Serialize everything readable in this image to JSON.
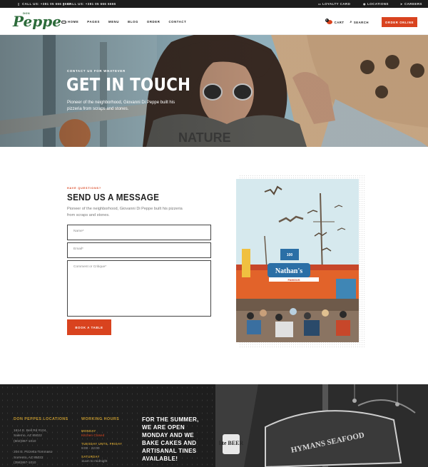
{
  "topbar": {
    "call1": "CALL US: +381 05 666 6666",
    "call2": "CALL US: +381 05 666 6666",
    "loyalty": "LOYALTY CARD",
    "locations": "LOCATIONS",
    "careers": "CAREERS"
  },
  "nav": {
    "logo": "Peppe",
    "logo_prefix": "DON",
    "menu": [
      "HOME",
      "PAGES",
      "MENU",
      "BLOG",
      "ORDER",
      "CONTACT"
    ],
    "cart_label": "CART",
    "cart_count": "0",
    "search_label": "SEARCH",
    "order_button": "ORDER ONLINE"
  },
  "hero": {
    "subtitle": "CONTACT US FOR WHATEVER",
    "title": "GET IN TOUCH",
    "text": "Pioneer of the neighborhood, Giovanni Di Peppe built his pizzeria from scraps and stones."
  },
  "form": {
    "kicker": "HAVE QUESTIONS?",
    "title": "SEND US A MESSAGE",
    "desc": "Pioneer of the neighborhood, Giovanni Di Peppe built his pizzeria from scraps and stones.",
    "name_placeholder": "Name*",
    "email_placeholder": "Email*",
    "comment_placeholder": "Comment or Critique*",
    "button": "BOOK A TABLE"
  },
  "photo": {
    "sign": "Nathan's",
    "banner": "FAMOUS"
  },
  "footer": {
    "locations_title": "DON PEPPES LOCATIONS",
    "loc1_line1": "1614 E. Bell Rd #104,",
    "loc1_line2": "Salerno, AZ 85022",
    "loc1_phone": "(602)867-1010",
    "loc2_line1": "204 E. Pizzetta Tommaso",
    "loc2_line2": "Sorrento, AZ 85022",
    "loc2_phone": "(358)867-1010",
    "hours_title": "WORKING HOURS",
    "day1": "MONDAY",
    "day1_val": "Kitchen Closed",
    "day2": "TUESDAY UNTIL FRIDAY",
    "day2_val": "9:00 - 22:00",
    "day3": "SATURDAY",
    "day3_val": "11am to midnight",
    "promo": "FOR THE SUMMER, WE ARE OPEN MONDAY AND WE BAKE CAKES AND ARTISANAL TINES AVAILABLE!",
    "photo_sign1": "lite BEER",
    "photo_sign2": "HYMANS SEAFOOD"
  },
  "colors": {
    "accent": "#d9431f",
    "gold": "#c69a2f",
    "brand_green": "#2c6b3a",
    "dark": "#1c1c1c"
  }
}
